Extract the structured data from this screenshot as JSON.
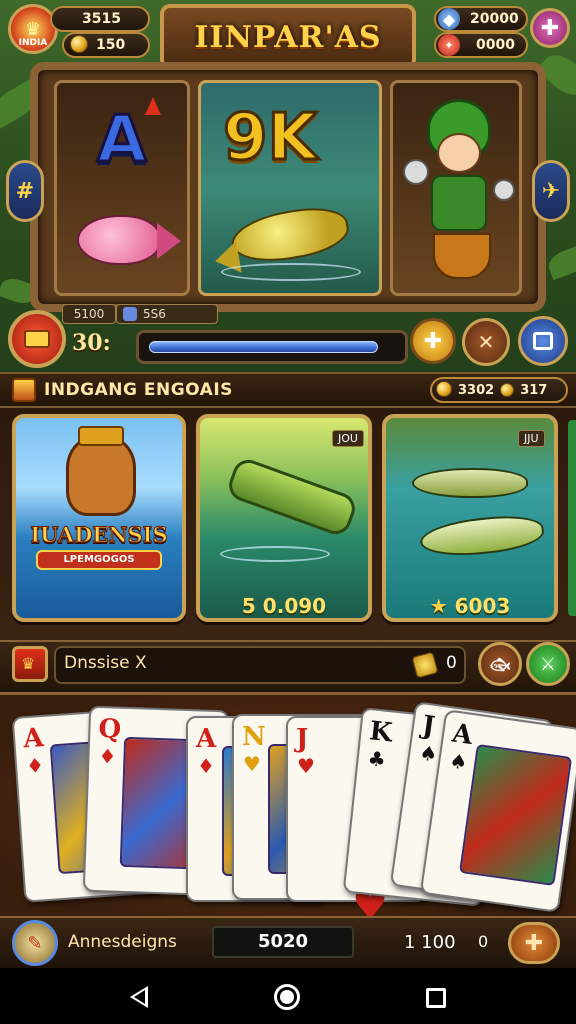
{
  "hud": {
    "left_top_value": "3515",
    "left_icon_label": "INDIA",
    "left_bottom_value": "150",
    "right_top_value": "20000",
    "right_bottom_value": "0000"
  },
  "title": "IINPAR'AS",
  "reels": {
    "left_letter": "A",
    "mid_letters": "9K"
  },
  "bet": {
    "box_left": "5100",
    "box_right": "5S6",
    "amount": "30:"
  },
  "progress": {
    "fraction": 0.93
  },
  "section": {
    "title": "INDGANG ENGOAIS",
    "currency_a": "3302",
    "currency_b": "317"
  },
  "cards": [
    {
      "banner": "IUADENSIS",
      "subtitle": "LPEMGOGOS"
    },
    {
      "tag": "JOU",
      "price": "5 0.090"
    },
    {
      "tag": "JJU",
      "price": "6003"
    }
  ],
  "task": {
    "label": "Dnssise X",
    "count": "0"
  },
  "hand": [
    {
      "rank": "A",
      "suit": "♦",
      "color": "#d0201a"
    },
    {
      "rank": "Q",
      "suit": "♦",
      "color": "#d0201a"
    },
    {
      "rank": "A",
      "suit": "♦",
      "color": "#d0201a"
    },
    {
      "rank": "N",
      "suit": "♥",
      "color": "#e0a010"
    },
    {
      "rank": "J",
      "suit": "♥",
      "color": "#d0201a"
    },
    {
      "rank": "K",
      "suit": "♣",
      "color": "#111111"
    },
    {
      "rank": "J",
      "suit": "♠",
      "color": "#111111"
    },
    {
      "rank": "A",
      "suit": "♠",
      "color": "#111111"
    }
  ],
  "footer": {
    "label": "Annesdeigns",
    "value_mid": "5020",
    "value_right": "1 100",
    "value_zero": "0"
  },
  "colors": {
    "gold": "#c9a256",
    "accent_red": "#d0201a",
    "progress_blue": "#3a6ad0"
  }
}
